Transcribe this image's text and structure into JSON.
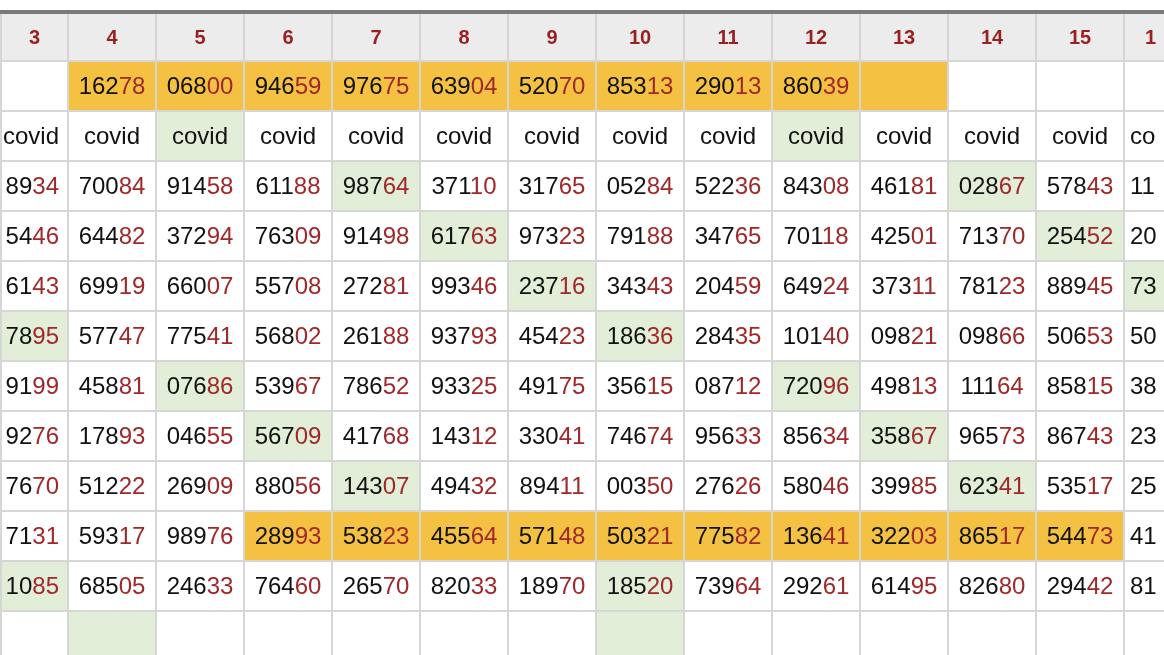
{
  "columns": [
    "3",
    "4",
    "5",
    "6",
    "7",
    "8",
    "9",
    "10",
    "11",
    "12",
    "13",
    "14",
    "15",
    "1"
  ],
  "rows": [
    {
      "cells": [
        {},
        {
          "text": "162",
          "tail": "78",
          "color": "#f4c142"
        },
        {
          "text": "068",
          "tail": "00",
          "color": "#f4c142"
        },
        {
          "text": "946",
          "tail": "59",
          "color": "#f4c142"
        },
        {
          "text": "976",
          "tail": "75",
          "color": "#f4c142"
        },
        {
          "text": "639",
          "tail": "04",
          "color": "#f4c142"
        },
        {
          "text": "520",
          "tail": "70",
          "color": "#f4c142"
        },
        {
          "text": "853",
          "tail": "13",
          "color": "#f4c142"
        },
        {
          "text": "290",
          "tail": "13",
          "color": "#f4c142"
        },
        {
          "text": "860",
          "tail": "39",
          "color": "#f4c142"
        },
        {
          "color": "#f4c142"
        },
        {},
        {},
        {}
      ]
    },
    {
      "cells": [
        {
          "text": "covid"
        },
        {
          "text": "covid"
        },
        {
          "text": "covid",
          "color": "#e2eed8"
        },
        {
          "text": "covid"
        },
        {
          "text": "covid"
        },
        {
          "text": "covid"
        },
        {
          "text": "covid"
        },
        {
          "text": "covid"
        },
        {
          "text": "covid"
        },
        {
          "text": "covid",
          "color": "#e2eed8"
        },
        {
          "text": "covid"
        },
        {
          "text": "covid"
        },
        {
          "text": "covid"
        },
        {
          "text": "co"
        }
      ]
    },
    {
      "cells": [
        {
          "text": "89",
          "tail": "34"
        },
        {
          "text": "700",
          "tail": "84"
        },
        {
          "text": "914",
          "tail": "58"
        },
        {
          "text": "611",
          "tail": "88"
        },
        {
          "text": "987",
          "tail": "64",
          "color": "#e2eed8"
        },
        {
          "text": "371",
          "tail": "10"
        },
        {
          "text": "317",
          "tail": "65"
        },
        {
          "text": "052",
          "tail": "84"
        },
        {
          "text": "522",
          "tail": "36"
        },
        {
          "text": "843",
          "tail": "08"
        },
        {
          "text": "461",
          "tail": "81"
        },
        {
          "text": "028",
          "tail": "67",
          "color": "#e2eed8"
        },
        {
          "text": "578",
          "tail": "43"
        },
        {
          "text": "11"
        }
      ]
    },
    {
      "cells": [
        {
          "text": "54",
          "tail": "46"
        },
        {
          "text": "644",
          "tail": "82"
        },
        {
          "text": "372",
          "tail": "94"
        },
        {
          "text": "763",
          "tail": "09"
        },
        {
          "text": "914",
          "tail": "98"
        },
        {
          "text": "617",
          "tail": "63",
          "color": "#e2eed8"
        },
        {
          "text": "973",
          "tail": "23"
        },
        {
          "text": "791",
          "tail": "88"
        },
        {
          "text": "347",
          "tail": "65"
        },
        {
          "text": "701",
          "tail": "18"
        },
        {
          "text": "425",
          "tail": "01"
        },
        {
          "text": "713",
          "tail": "70"
        },
        {
          "text": "254",
          "tail": "52",
          "color": "#e2eed8"
        },
        {
          "text": "20"
        }
      ]
    },
    {
      "cells": [
        {
          "text": "61",
          "tail": "43"
        },
        {
          "text": "699",
          "tail": "19"
        },
        {
          "text": "660",
          "tail": "07"
        },
        {
          "text": "557",
          "tail": "08"
        },
        {
          "text": "272",
          "tail": "81"
        },
        {
          "text": "993",
          "tail": "46"
        },
        {
          "text": "237",
          "tail": "16",
          "color": "#e2eed8"
        },
        {
          "text": "343",
          "tail": "43"
        },
        {
          "text": "204",
          "tail": "59"
        },
        {
          "text": "649",
          "tail": "24"
        },
        {
          "text": "373",
          "tail": "11"
        },
        {
          "text": "781",
          "tail": "23"
        },
        {
          "text": "889",
          "tail": "45"
        },
        {
          "text": "73",
          "color": "#e2eed8"
        }
      ]
    },
    {
      "cells": [
        {
          "text": "78",
          "tail": "95",
          "color": "#e2eed8"
        },
        {
          "text": "577",
          "tail": "47"
        },
        {
          "text": "775",
          "tail": "41"
        },
        {
          "text": "568",
          "tail": "02"
        },
        {
          "text": "261",
          "tail": "88"
        },
        {
          "text": "937",
          "tail": "93"
        },
        {
          "text": "454",
          "tail": "23"
        },
        {
          "text": "186",
          "tail": "36",
          "color": "#e2eed8"
        },
        {
          "text": "284",
          "tail": "35"
        },
        {
          "text": "101",
          "tail": "40"
        },
        {
          "text": "098",
          "tail": "21"
        },
        {
          "text": "098",
          "tail": "66"
        },
        {
          "text": "506",
          "tail": "53"
        },
        {
          "text": "50"
        }
      ]
    },
    {
      "cells": [
        {
          "text": "91",
          "tail": "99"
        },
        {
          "text": "458",
          "tail": "81"
        },
        {
          "text": "076",
          "tail": "86",
          "color": "#e2eed8"
        },
        {
          "text": "539",
          "tail": "67"
        },
        {
          "text": "786",
          "tail": "52"
        },
        {
          "text": "933",
          "tail": "25"
        },
        {
          "text": "491",
          "tail": "75"
        },
        {
          "text": "356",
          "tail": "15"
        },
        {
          "text": "087",
          "tail": "12"
        },
        {
          "text": "720",
          "tail": "96",
          "color": "#e2eed8"
        },
        {
          "text": "498",
          "tail": "13"
        },
        {
          "text": "111",
          "tail": "64"
        },
        {
          "text": "858",
          "tail": "15"
        },
        {
          "text": "38"
        }
      ]
    },
    {
      "cells": [
        {
          "text": "92",
          "tail": "76"
        },
        {
          "text": "178",
          "tail": "93"
        },
        {
          "text": "046",
          "tail": "55"
        },
        {
          "text": "567",
          "tail": "09",
          "color": "#e2eed8"
        },
        {
          "text": "417",
          "tail": "68"
        },
        {
          "text": "143",
          "tail": "12"
        },
        {
          "text": "330",
          "tail": "41"
        },
        {
          "text": "746",
          "tail": "74"
        },
        {
          "text": "956",
          "tail": "33"
        },
        {
          "text": "856",
          "tail": "34"
        },
        {
          "text": "358",
          "tail": "67",
          "color": "#e2eed8"
        },
        {
          "text": "965",
          "tail": "73"
        },
        {
          "text": "867",
          "tail": "43"
        },
        {
          "text": "23"
        }
      ]
    },
    {
      "cells": [
        {
          "text": "76",
          "tail": "70"
        },
        {
          "text": "512",
          "tail": "22"
        },
        {
          "text": "269",
          "tail": "09"
        },
        {
          "text": "880",
          "tail": "56"
        },
        {
          "text": "143",
          "tail": "07",
          "color": "#e2eed8"
        },
        {
          "text": "494",
          "tail": "32"
        },
        {
          "text": "894",
          "tail": "11"
        },
        {
          "text": "003",
          "tail": "50"
        },
        {
          "text": "276",
          "tail": "26"
        },
        {
          "text": "580",
          "tail": "46"
        },
        {
          "text": "399",
          "tail": "85"
        },
        {
          "text": "623",
          "tail": "41",
          "color": "#e2eed8"
        },
        {
          "text": "535",
          "tail": "17"
        },
        {
          "text": "25"
        }
      ]
    },
    {
      "cells": [
        {
          "text": "71",
          "tail": "31"
        },
        {
          "text": "593",
          "tail": "17"
        },
        {
          "text": "989",
          "tail": "76"
        },
        {
          "text": "289",
          "tail": "93",
          "color": "#f4c142"
        },
        {
          "text": "538",
          "tail": "23",
          "color": "#f4c142"
        },
        {
          "text": "455",
          "tail": "64",
          "color": "#f4c142"
        },
        {
          "text": "571",
          "tail": "48",
          "color": "#f4c142"
        },
        {
          "text": "503",
          "tail": "21",
          "color": "#f4c142"
        },
        {
          "text": "775",
          "tail": "82",
          "color": "#f4c142"
        },
        {
          "text": "136",
          "tail": "41",
          "color": "#f4c142"
        },
        {
          "text": "322",
          "tail": "03",
          "color": "#f4c142"
        },
        {
          "text": "865",
          "tail": "17",
          "color": "#f4c142"
        },
        {
          "text": "544",
          "tail": "73",
          "color": "#f4c142"
        },
        {
          "text": "41"
        }
      ]
    },
    {
      "cells": [
        {
          "text": "10",
          "tail": "85",
          "color": "#e2eed8"
        },
        {
          "text": "685",
          "tail": "05"
        },
        {
          "text": "246",
          "tail": "33"
        },
        {
          "text": "764",
          "tail": "60"
        },
        {
          "text": "265",
          "tail": "70"
        },
        {
          "text": "820",
          "tail": "33"
        },
        {
          "text": "189",
          "tail": "70"
        },
        {
          "text": "185",
          "tail": "20",
          "color": "#e2eed8"
        },
        {
          "text": "739",
          "tail": "64"
        },
        {
          "text": "292",
          "tail": "61"
        },
        {
          "text": "614",
          "tail": "95"
        },
        {
          "text": "826",
          "tail": "80"
        },
        {
          "text": "294",
          "tail": "42"
        },
        {
          "text": "81"
        }
      ]
    },
    {
      "cells": [
        {},
        {
          "color": "#e2eed8"
        },
        {},
        {},
        {},
        {},
        {},
        {
          "color": "#e2eed8"
        },
        {},
        {},
        {},
        {},
        {},
        {}
      ]
    }
  ]
}
